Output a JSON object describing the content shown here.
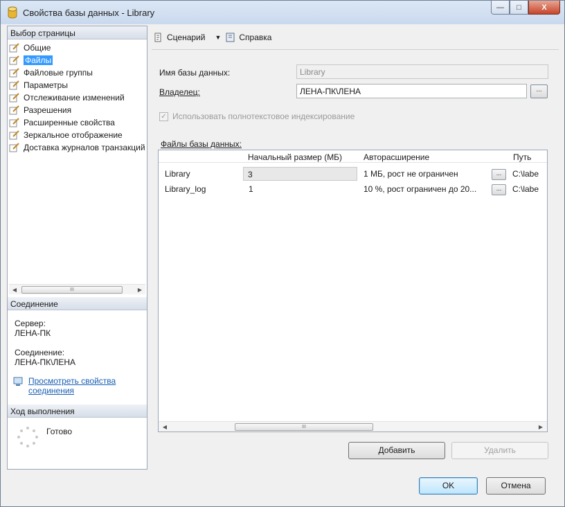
{
  "window": {
    "title": "Свойства базы данных - Library",
    "caption_buttons": {
      "minimize": "—",
      "maximize": "□",
      "close": "X"
    }
  },
  "left_pane": {
    "select_page_header": "Выбор страницы",
    "pages": [
      {
        "label": "Общие",
        "selected": false
      },
      {
        "label": "Файлы",
        "selected": true
      },
      {
        "label": "Файловые группы",
        "selected": false
      },
      {
        "label": "Параметры",
        "selected": false
      },
      {
        "label": "Отслеживание изменений",
        "selected": false
      },
      {
        "label": "Разрешения",
        "selected": false
      },
      {
        "label": "Расширенные свойства",
        "selected": false
      },
      {
        "label": "Зеркальное отображение",
        "selected": false
      },
      {
        "label": "Доставка журналов транзакций",
        "selected": false
      }
    ],
    "connection_header": "Соединение",
    "server_label": "Сервер:",
    "server_value": "ЛЕНА-ПК",
    "connection_label": "Соединение:",
    "connection_value": "ЛЕНА-ПК\\ЛЕНА",
    "view_connection_link": "Просмотреть свойства соединения",
    "progress_header": "Ход выполнения",
    "progress_status": "Готово"
  },
  "toolbar": {
    "script_label": "Сценарий",
    "help_label": "Справка"
  },
  "form": {
    "db_name_label": "Имя базы данных:",
    "db_name_value": "Library",
    "owner_label": "Владелец:",
    "owner_value": "ЛЕНА-ПК\\ЛЕНА",
    "browse_label": "...",
    "fulltext_label": "Использовать полнотекстовое индексирование",
    "fulltext_checked": true,
    "files_label": "Файлы базы данных:"
  },
  "files_grid": {
    "columns": [
      "Начальный размер (МБ)",
      "Авторасширение",
      "Путь"
    ],
    "rows": [
      {
        "name": "Library",
        "size": "3",
        "autogrowth": "1 МБ, рост не ограничен",
        "browse": "...",
        "path": "C:\\labe"
      },
      {
        "name": "Library_log",
        "size": "1",
        "autogrowth": "10 %, рост ограничен до 20...",
        "browse": "...",
        "path": "C:\\labe"
      }
    ]
  },
  "buttons": {
    "add": "Добавить",
    "remove": "Удалить",
    "ok": "OK",
    "cancel": "Отмена"
  }
}
